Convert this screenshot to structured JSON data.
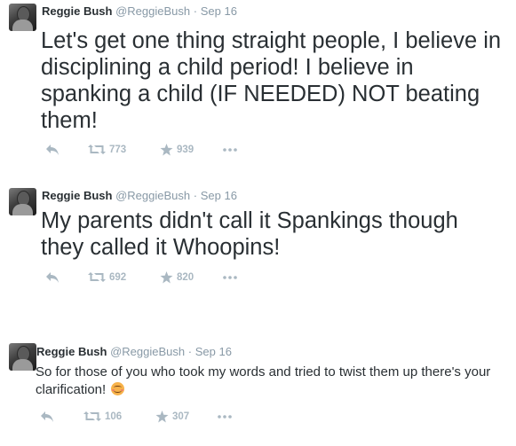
{
  "tweets": [
    {
      "name": "Reggie Bush",
      "handle": "@ReggieBush",
      "separator": "·",
      "date": "Sep 16",
      "text": "Let's get one thing straight people, I believe in disciplining a child period! I believe in spanking a child (IF NEEDED) NOT beating them!",
      "retweets": "773",
      "favorites": "939"
    },
    {
      "name": "Reggie Bush",
      "handle": "@ReggieBush",
      "separator": "·",
      "date": "Sep 16",
      "text": "My parents didn't call it Spankings though they called it Whoopins!",
      "retweets": "692",
      "favorites": "820"
    },
    {
      "name": "Reggie Bush",
      "handle": "@ReggieBush",
      "separator": "·",
      "date": "Sep 16",
      "text": "So for those of you who took my words and tried to twist them up there's your clarification!",
      "retweets": "106",
      "favorites": "307"
    }
  ],
  "icons": {
    "reply": "reply-arrow-icon",
    "retweet": "retweet-icon",
    "favorite": "star-icon",
    "more": "more-dots-icon",
    "emoji": "blush-emoji-icon"
  },
  "colors": {
    "text": "#292f33",
    "meta": "#8899a6",
    "action": "#aab8c2"
  }
}
